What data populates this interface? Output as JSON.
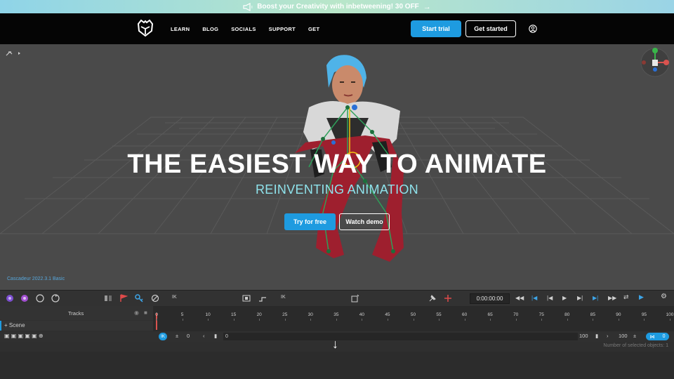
{
  "promo": {
    "text": "Boost your Creativity with inbetweening! 30 OFF",
    "arrow": "→"
  },
  "nav": {
    "links": [
      "LEARN",
      "BLOG",
      "SOCIALS",
      "SUPPORT",
      "GET"
    ],
    "start_trial": "Start trial",
    "get_started": "Get started"
  },
  "hero": {
    "title": "THE EASIEST WAY TO ANIMATE",
    "subtitle": "REINVENTING ANIMATION",
    "try_free": "Try for free",
    "watch_demo": "Watch demo"
  },
  "viewport": {
    "version": "Cascadeur 2022.3.1 Basic"
  },
  "toolbar": {
    "timecode": "0:00:00:00",
    "ik1": "IK",
    "ik2": "IK"
  },
  "tracks": {
    "header": "Tracks",
    "scene": "+ Scene",
    "ticks": [
      "0",
      "5",
      "10",
      "15",
      "20",
      "25",
      "30",
      "35",
      "40",
      "45",
      "50",
      "55",
      "60",
      "65",
      "70",
      "75",
      "80",
      "85",
      "90",
      "95",
      "100"
    ],
    "frame_start": "0",
    "frame_current": "0",
    "frame_end": "100",
    "frame_end2": "100",
    "frame_counter": "0",
    "status": "Number of selected objects: 1"
  },
  "colors": {
    "accent": "#1e9be0",
    "subtitle": "#8fe3ec",
    "banner": "#b9e6c9"
  }
}
